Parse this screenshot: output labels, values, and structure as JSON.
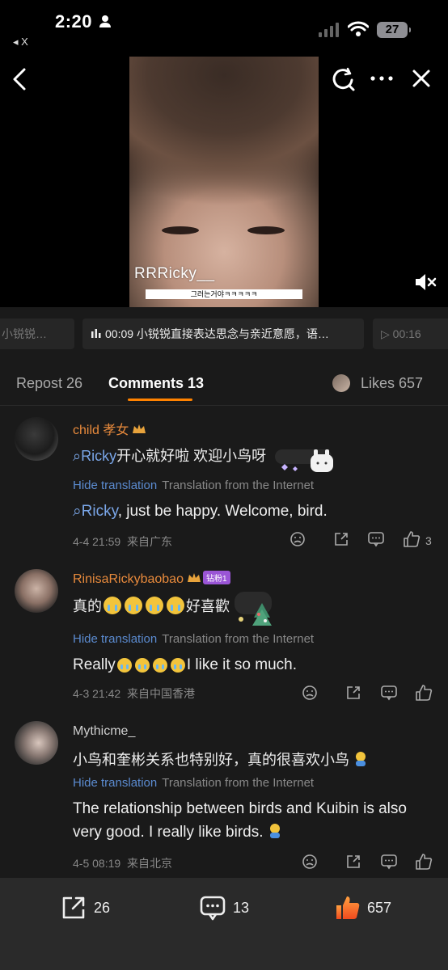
{
  "status_bar": {
    "time": "2:20",
    "back_app": "◂ X",
    "battery": "27"
  },
  "video": {
    "watermark": "RRRicky__",
    "subtitle": "그러는거야ㅋㅋㅋㅋㅋ"
  },
  "episodes": [
    {
      "label": "小锐锐…"
    },
    {
      "label": "00:09 小锐锐直接表达思念与亲近意愿，语…"
    },
    {
      "label": "▷ 00:16"
    }
  ],
  "tabs": {
    "repost": "Repost 26",
    "comments": "Comments 13",
    "likes": "Likes 657"
  },
  "comments": [
    {
      "username": "child 孝女",
      "mention": "Ricky",
      "text": "开心就好啦 欢迎小鸟呀",
      "hide_translation": "Hide translation",
      "translation_source": "Translation from the Internet",
      "translation_mention": "Ricky",
      "translation": ", just be happy. Welcome, bird.",
      "date": "4-4 21:59",
      "location": "来自广东",
      "like_count": "3",
      "colors": {
        "username": "#e88a3c"
      }
    },
    {
      "username": "RinisaRickybaobao",
      "badge": "钻粉1",
      "text_before": "真的",
      "text_after": "好喜歡",
      "hide_translation": "Hide translation",
      "translation_source": "Translation from the Internet",
      "translation_before": "Really",
      "translation_after": "I like it so much.",
      "date": "4-3 21:42",
      "location": "来自中国香港",
      "colors": {
        "username": "#e88a3c"
      }
    },
    {
      "username": "Mythicme_",
      "text": "小鸟和奎彬关系也特别好，真的很喜欢小鸟",
      "hide_translation": "Hide translation",
      "translation_source": "Translation from the Internet",
      "translation": "The relationship between birds and Kuibin is also very good. I really like birds.",
      "date": "4-5 08:19",
      "location": "来自北京",
      "colors": {
        "username": "#cfcfcf"
      }
    }
  ],
  "bottom_bar": {
    "repost_count": "26",
    "comment_count": "13",
    "like_count": "657"
  },
  "colors": {
    "accent": "#ff8200",
    "link": "#5b8bd0",
    "background": "#1a1a1a"
  },
  "icons": [
    "person-icon",
    "signal-icon",
    "wifi-icon",
    "back-icon",
    "search-refresh-icon",
    "more-icon",
    "close-icon",
    "mute-icon",
    "dislike-icon",
    "share-icon",
    "comment-icon",
    "like-icon",
    "repost-icon"
  ]
}
